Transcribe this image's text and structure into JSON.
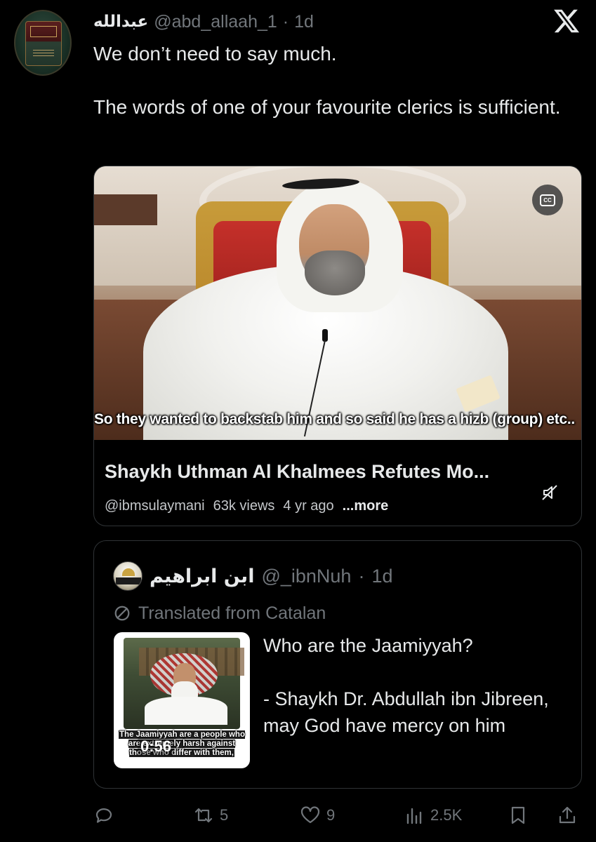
{
  "tweet": {
    "display_name": "عبدالله",
    "handle": "@abd_allaah_1",
    "separator": "·",
    "time": "1d",
    "text_paragraphs": [
      "We don’t need to say much.",
      "The words of one of your favourite clerics is sufficient."
    ]
  },
  "video": {
    "subtitle": "So they wanted to backstab him and so said he has a hizb (group) etc..",
    "title": "Shaykh Uthman Al Khalmees Refutes Mo...",
    "channel": "@ibmsulaymani",
    "views": "63k views",
    "age": "4 yr ago",
    "more_label": "...more",
    "cc_label": "CC"
  },
  "quote": {
    "display_name": "ابن ابراهيم",
    "handle": "@_ibnNuh",
    "separator": "·",
    "time": "1d",
    "translated_label": "Translated from Catalan",
    "thumb_caption": "The Jaamiyyah are a people who are extremely harsh against those who differ with them,",
    "thumb_duration": "0:56",
    "text_paragraphs": [
      "Who are the Jaamiyyah?",
      "- Shaykh Dr. Abdullah ibn Jibreen, may God have mercy on him"
    ]
  },
  "actions": {
    "reply_count": "",
    "retweet_count": "5",
    "like_count": "9",
    "views_count": "2.5K"
  },
  "colors": {
    "background": "#000000",
    "text_primary": "#e7e9ea",
    "text_secondary": "#71767b",
    "border": "#2f3336"
  }
}
